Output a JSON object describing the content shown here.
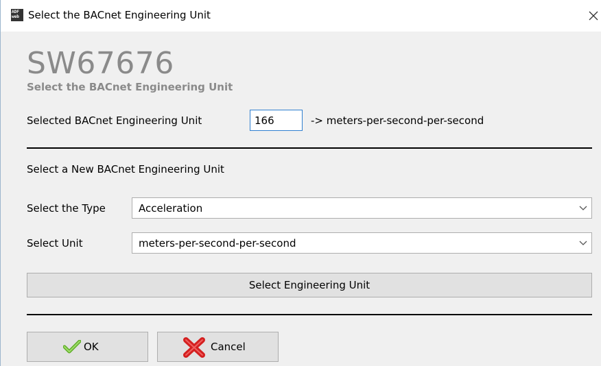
{
  "window": {
    "title": "Select the BACnet Engineering Unit",
    "app_icon_lines": [
      "ADF",
      "web"
    ]
  },
  "header": {
    "product": "SW67676",
    "subtitle": "Select the BACnet Engineering Unit"
  },
  "selected": {
    "label": "Selected BACnet Engineering Unit",
    "value": "166",
    "description": "-> meters-per-second-per-second"
  },
  "new_unit": {
    "section_label": "Select a New BACnet Engineering Unit",
    "type_label": "Select the Type",
    "type_value": "Acceleration",
    "unit_label": "Select Unit",
    "unit_value": "meters-per-second-per-second",
    "select_button": "Select Engineering Unit"
  },
  "footer": {
    "ok_label": "OK",
    "cancel_label": "Cancel"
  },
  "icons": {
    "ok": "checkmark-icon",
    "cancel": "red-x-icon",
    "close": "close-icon",
    "dropdown": "chevron-down-icon"
  },
  "colors": {
    "title_gray": "#8a8a8a",
    "input_focus": "#2f7fd0",
    "check_green": "#5fae28",
    "cancel_red": "#d42020"
  }
}
